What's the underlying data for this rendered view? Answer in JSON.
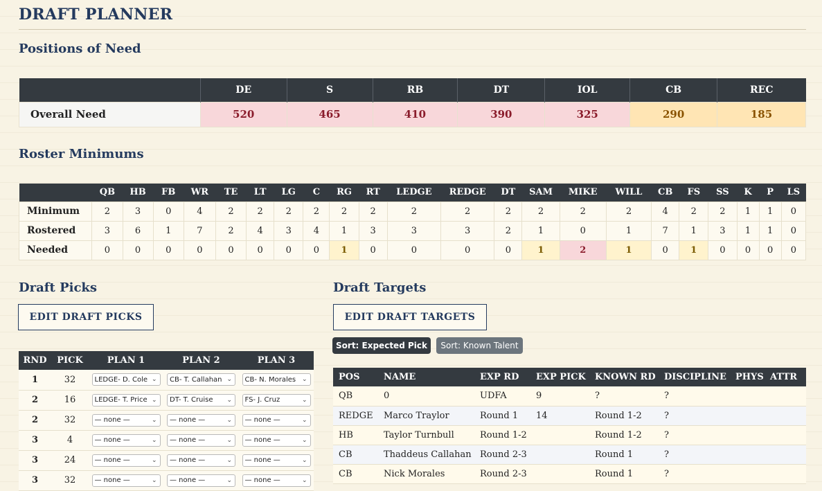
{
  "page": {
    "title": "DRAFT PLANNER"
  },
  "needs": {
    "heading": "Positions of Need",
    "row_label": "Overall Need",
    "columns": [
      {
        "pos": "DE",
        "value": "520",
        "level": "high"
      },
      {
        "pos": "S",
        "value": "465",
        "level": "high"
      },
      {
        "pos": "RB",
        "value": "410",
        "level": "high"
      },
      {
        "pos": "DT",
        "value": "390",
        "level": "high"
      },
      {
        "pos": "IOL",
        "value": "325",
        "level": "high"
      },
      {
        "pos": "CB",
        "value": "290",
        "level": "medium"
      },
      {
        "pos": "REC",
        "value": "185",
        "level": "medium"
      }
    ],
    "colors": {
      "high_bg": "#f8d7da",
      "high_text": "#8a1c2b",
      "medium_bg": "#ffe5b4",
      "medium_text": "#8a5300"
    }
  },
  "roster": {
    "heading": "Roster Minimums",
    "positions": [
      "QB",
      "HB",
      "FB",
      "WR",
      "TE",
      "LT",
      "LG",
      "C",
      "RG",
      "RT",
      "LEDGE",
      "REDGE",
      "DT",
      "SAM",
      "MIKE",
      "WILL",
      "CB",
      "FS",
      "SS",
      "K",
      "P",
      "LS"
    ],
    "rows": [
      {
        "label": "Minimum",
        "values": [
          "2",
          "3",
          "0",
          "4",
          "2",
          "2",
          "2",
          "2",
          "2",
          "2",
          "2",
          "2",
          "2",
          "2",
          "2",
          "2",
          "4",
          "2",
          "2",
          "1",
          "1",
          "0"
        ]
      },
      {
        "label": "Rostered",
        "values": [
          "3",
          "6",
          "1",
          "7",
          "2",
          "4",
          "3",
          "4",
          "1",
          "3",
          "3",
          "3",
          "2",
          "1",
          "0",
          "1",
          "7",
          "1",
          "3",
          "1",
          "1",
          "0"
        ]
      },
      {
        "label": "Needed",
        "values": [
          "0",
          "0",
          "0",
          "0",
          "0",
          "0",
          "0",
          "0",
          "1",
          "0",
          "0",
          "0",
          "0",
          "1",
          "2",
          "1",
          "0",
          "1",
          "0",
          "0",
          "0",
          "0"
        ]
      }
    ]
  },
  "picks": {
    "heading": "Draft Picks",
    "edit_label": "EDIT DRAFT PICKS",
    "headers": [
      "RND",
      "PICK",
      "PLAN 1",
      "PLAN 2",
      "PLAN 3"
    ],
    "rows": [
      {
        "rnd": "1",
        "pick": "32",
        "plans": [
          "LEDGE- D. Cole",
          "CB- T. Callahan",
          "CB- N. Morales"
        ]
      },
      {
        "rnd": "2",
        "pick": "16",
        "plans": [
          "LEDGE- T. Price",
          "DT- T. Cruise",
          "FS- J. Cruz"
        ]
      },
      {
        "rnd": "2",
        "pick": "32",
        "plans": [
          "— none —",
          "— none —",
          "— none —"
        ]
      },
      {
        "rnd": "3",
        "pick": "4",
        "plans": [
          "— none —",
          "— none —",
          "— none —"
        ]
      },
      {
        "rnd": "3",
        "pick": "24",
        "plans": [
          "— none —",
          "— none —",
          "— none —"
        ]
      },
      {
        "rnd": "3",
        "pick": "32",
        "plans": [
          "— none —",
          "— none —",
          "— none —"
        ]
      }
    ]
  },
  "targets": {
    "heading": "Draft Targets",
    "edit_label": "EDIT DRAFT TARGETS",
    "sort_active": "Sort: Expected Pick",
    "sort_inactive": "Sort: Known Talent",
    "headers": [
      "POS",
      "NAME",
      "EXP RD",
      "EXP PICK",
      "KNOWN RD",
      "DISCIPLINE",
      "PHYS",
      "ATTR"
    ],
    "rows": [
      {
        "pos": "QB",
        "name": "0",
        "exp_rd": "UDFA",
        "exp_pick": "9",
        "known_rd": "?",
        "discipline": "?",
        "phys": "",
        "attr": ""
      },
      {
        "pos": "REDGE",
        "name": "Marco Traylor",
        "exp_rd": "Round 1",
        "exp_pick": "14",
        "known_rd": "Round 1-2",
        "discipline": "?",
        "phys": "",
        "attr": ""
      },
      {
        "pos": "HB",
        "name": "Taylor Turnbull",
        "exp_rd": "Round 1-2",
        "exp_pick": "",
        "known_rd": "Round 1-2",
        "discipline": "?",
        "phys": "",
        "attr": ""
      },
      {
        "pos": "CB",
        "name": "Thaddeus Callahan",
        "exp_rd": "Round 2-3",
        "exp_pick": "",
        "known_rd": "Round 1",
        "discipline": "?",
        "phys": "",
        "attr": ""
      },
      {
        "pos": "CB",
        "name": "Nick Morales",
        "exp_rd": "Round 2-3",
        "exp_pick": "",
        "known_rd": "Round 1",
        "discipline": "?",
        "phys": "",
        "attr": ""
      }
    ]
  },
  "icons": {
    "select_chevron": "chevron-down-icon"
  }
}
